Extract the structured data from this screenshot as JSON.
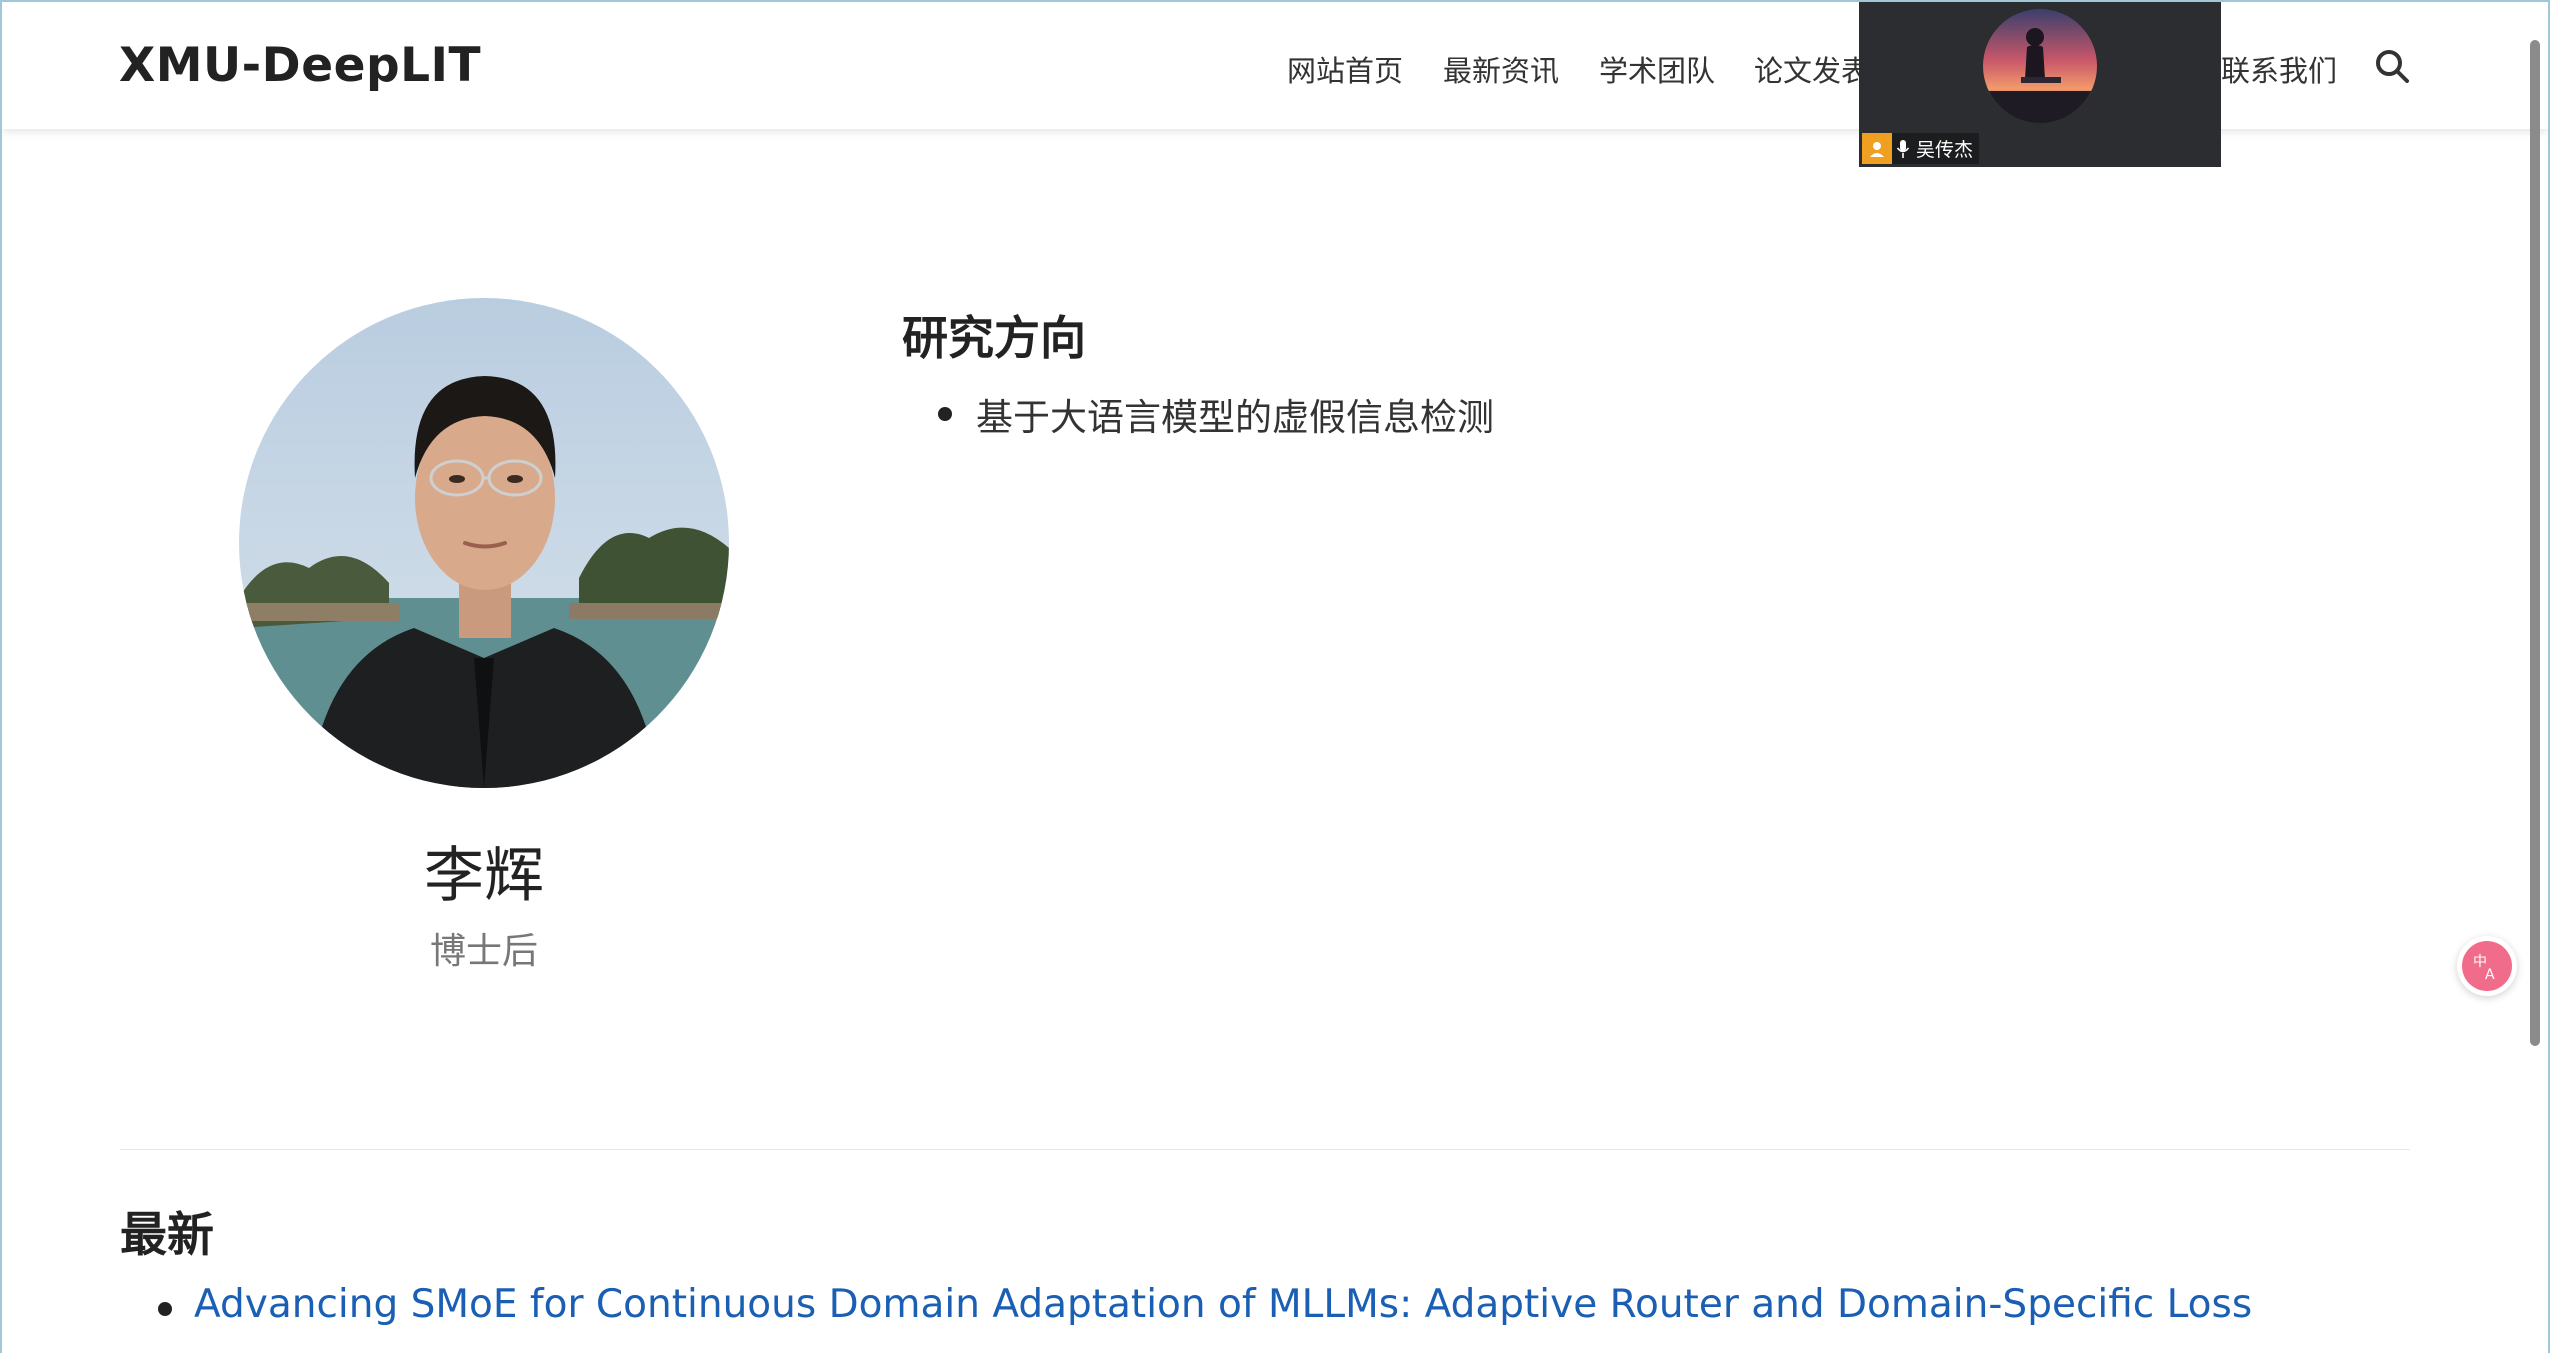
{
  "navbar": {
    "brand": "XMU-DeepLIT",
    "items": [
      {
        "label": "网站首页"
      },
      {
        "label": "最新资讯"
      },
      {
        "label": "学术团队"
      },
      {
        "label": "论文发表"
      },
      {
        "label": "联系我们"
      }
    ],
    "search_icon": "search-icon"
  },
  "video_overlay": {
    "participant_name": "吴传杰",
    "user_icon": "user-icon",
    "mic_icon": "microphone-icon"
  },
  "profile": {
    "name": "李辉",
    "role": "博士后"
  },
  "research": {
    "title": "研究方向",
    "items": [
      "基于大语言模型的虚假信息检测"
    ]
  },
  "latest": {
    "title": "最新",
    "items": [
      "Advancing SMoE for Continuous Domain Adaptation of MLLMs: Adaptive Router and Domain-Specific Loss"
    ]
  },
  "colors": {
    "link": "#1a5fb4",
    "translate_accent": "#f06c8a",
    "overlay_bg": "#2b2d30"
  }
}
